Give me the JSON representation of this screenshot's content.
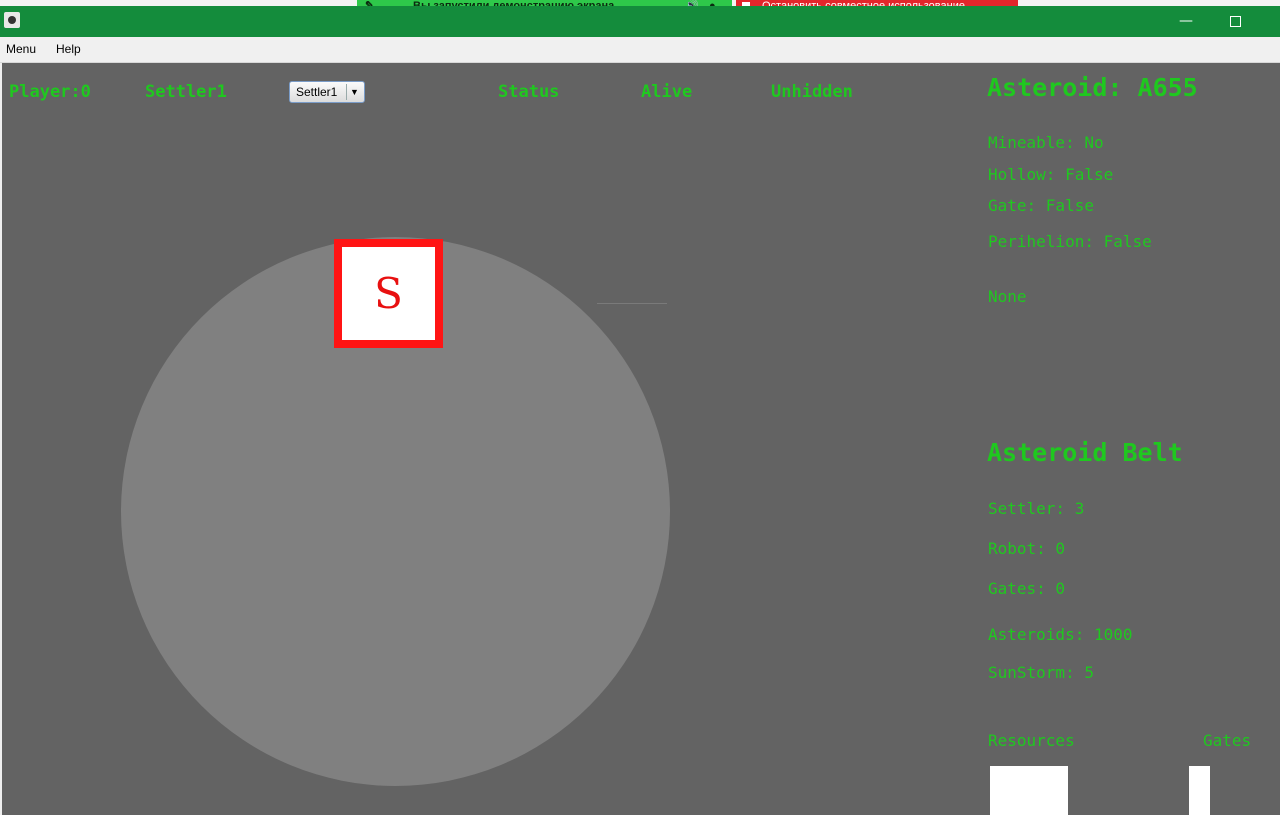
{
  "share_banner": {
    "message": "Вы запустили демонстрацию экрана",
    "stop_label": "Остановить совместное использование"
  },
  "window": {
    "minimize_glyph": "—"
  },
  "menubar": {
    "items": [
      "Menu",
      "Help"
    ]
  },
  "header": {
    "player": "Player:0",
    "settler_name": "Settler1",
    "settler_select_value": "Settler1",
    "status_label": "Status",
    "status_value": "Alive",
    "visibility": "Unhidden"
  },
  "canvas": {
    "settler_marker": "S"
  },
  "asteroid_panel": {
    "title": "Asteroid: A655",
    "mineable": "Mineable: No",
    "hollow": "Hollow: False",
    "gate": "Gate: False",
    "perihelion": "Perihelion: False",
    "resource": "None"
  },
  "belt_panel": {
    "title": "Asteroid Belt",
    "settler": "Settler: 3",
    "robot": "Robot: 0",
    "gates": "Gates: 0",
    "asteroids": "Asteroids: 1000",
    "sunstorm": "SunStorm: 5"
  },
  "inventory": {
    "resources_label": "Resources",
    "gates_label": "Gates"
  },
  "colors": {
    "accent": "#1fc81f",
    "background": "#636363",
    "asteroid": "#808080",
    "settler": "#ff1414",
    "titlebar": "#148c3c"
  }
}
